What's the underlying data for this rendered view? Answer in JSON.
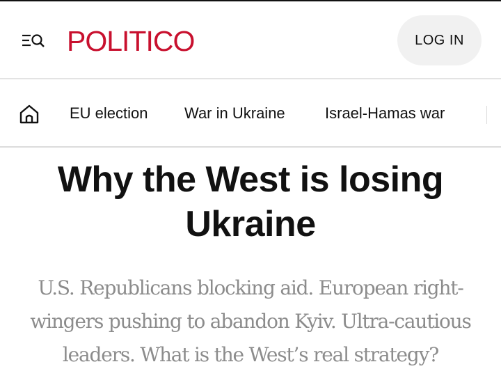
{
  "header": {
    "logo": "POLITICO",
    "login_label": "LOG IN",
    "menu_icon": "menu-search-icon"
  },
  "nav": {
    "home_icon": "home-icon",
    "items": [
      {
        "label": "EU election"
      },
      {
        "label": "War in Ukraine"
      },
      {
        "label": "Israel-Hamas war"
      }
    ]
  },
  "article": {
    "title": "Why the West is losing Ukraine",
    "dek": "U.S. Republicans blocking aid. European right-wingers pushing to abandon Kyiv. Ultra-cautious leaders. What is the West’s real strategy?"
  },
  "colors": {
    "brand": "#c8102e",
    "login_bg": "#f1f1f1",
    "dek_text": "#8c8c8c"
  }
}
